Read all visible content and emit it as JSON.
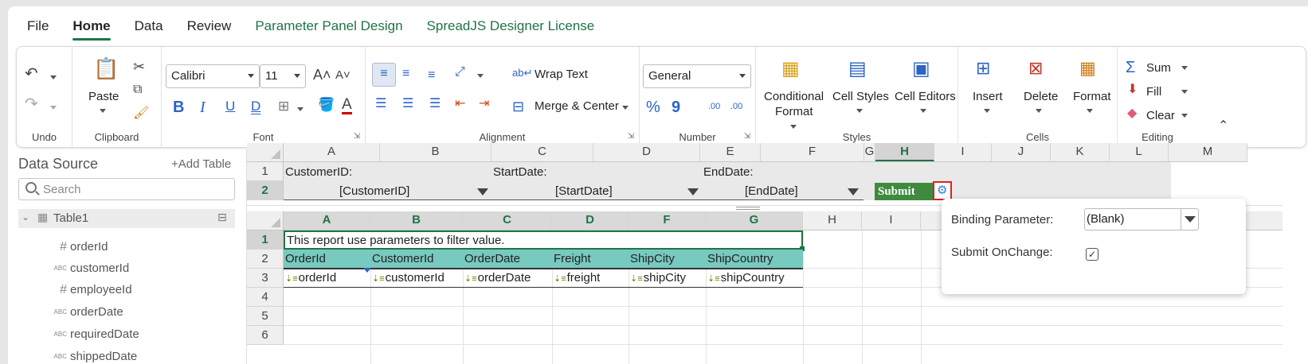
{
  "tabs": [
    "File",
    "Home",
    "Data",
    "Review",
    "Parameter Panel Design",
    "SpreadJS Designer License"
  ],
  "ribbon": {
    "undo_group": "Undo",
    "clipboard_group": "Clipboard",
    "paste": "Paste",
    "font_group": "Font",
    "font_name": "Calibri",
    "font_size": "11",
    "bold": "B",
    "italic": "I",
    "underline": "U",
    "dunderline": "D",
    "alignment_group": "Alignment",
    "wrap_text": "Wrap Text",
    "merge_center": "Merge & Center",
    "number_group": "Number",
    "number_format": "General",
    "percent": "%",
    "comma": "9",
    "inc_decimal": ".00",
    "dec_decimal": ".00",
    "styles_group": "Styles",
    "conditional_format_1": "Conditional",
    "conditional_format_2": "Format",
    "cell_styles": "Cell Styles",
    "cell_editors": "Cell Editors",
    "cells_group": "Cells",
    "insert": "Insert",
    "delete": "Delete",
    "format": "Format",
    "editing_group": "Editing",
    "sum": "Sum",
    "fill": "Fill",
    "clear": "Clear"
  },
  "data_source": {
    "title": "Data Source",
    "add_table": "Add Table",
    "search_placeholder": "Search",
    "table": "Table1",
    "fields": [
      {
        "type": "#",
        "name": "orderId"
      },
      {
        "type": "ABC",
        "name": "customerId"
      },
      {
        "type": "#",
        "name": "employeeId"
      },
      {
        "type": "ABC",
        "name": "orderDate"
      },
      {
        "type": "ABC",
        "name": "requiredDate"
      },
      {
        "type": "ABC",
        "name": "shippedDate"
      }
    ]
  },
  "param_sheet": {
    "cols": [
      "A",
      "B",
      "C",
      "D",
      "E",
      "F",
      "G",
      "H",
      "I",
      "J",
      "K",
      "L",
      "M"
    ],
    "rows": [
      "1",
      "2"
    ],
    "customer_label": "CustomerID:",
    "start_label": "StartDate:",
    "end_label": "EndDate:",
    "customer_value": "[CustomerID]",
    "start_value": "[StartDate]",
    "end_value": "[EndDate]",
    "submit": "Submit"
  },
  "report_sheet": {
    "cols": [
      "A",
      "B",
      "C",
      "D",
      "F",
      "G",
      "H",
      "I"
    ],
    "rows": [
      "1",
      "2",
      "3",
      "4",
      "5",
      "6"
    ],
    "note": "This report use parameters to filter value.",
    "headers": [
      "OrderId",
      "CustomerId",
      "OrderDate",
      "Freight",
      "ShipCity",
      "ShipCountry"
    ],
    "bindings": [
      "orderId",
      "customerId",
      "orderDate",
      "freight",
      "shipCity",
      "shipCountry"
    ]
  },
  "popup": {
    "binding_label": "Binding Parameter:",
    "binding_value": "(Blank)",
    "submit_onchange_label": "Submit OnChange:",
    "submit_onchange_checked": true
  },
  "colors": {
    "accent": "#217346",
    "table_band": "#78c9c0",
    "submit_bg": "#3f8a3f",
    "gear": "#2f7fd6"
  }
}
